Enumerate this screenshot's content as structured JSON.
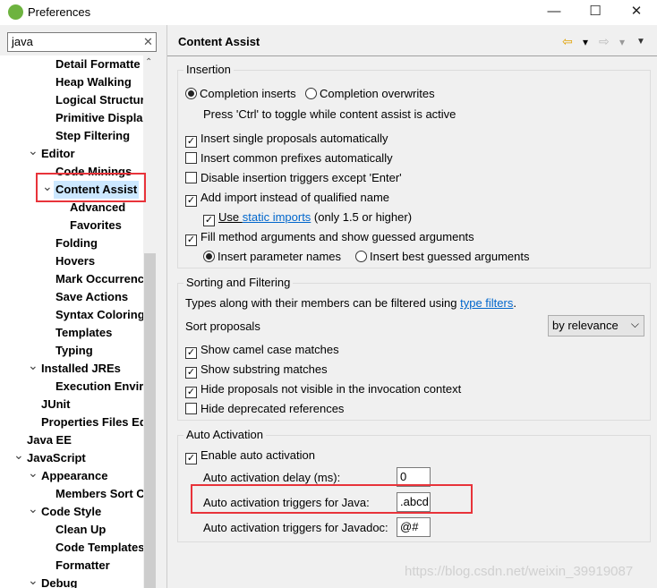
{
  "window": {
    "title": "Preferences",
    "minimize": "—",
    "maximize": "☐",
    "close": "✕"
  },
  "search": {
    "value": "java",
    "clear_icon": "✕"
  },
  "tree": [
    {
      "label": "Detail Formatte",
      "level": 3
    },
    {
      "label": "Heap Walking",
      "level": 3
    },
    {
      "label": "Logical Structur",
      "level": 3
    },
    {
      "label": "Primitive Displa",
      "level": 3
    },
    {
      "label": "Step Filtering",
      "level": 3
    },
    {
      "label": "Editor",
      "level": 2,
      "expanded": true
    },
    {
      "label": "Code Minings",
      "level": 3
    },
    {
      "label": "Content Assist",
      "level": 3,
      "expanded": true,
      "selected": true
    },
    {
      "label": "Advanced",
      "level": 4
    },
    {
      "label": "Favorites",
      "level": 4
    },
    {
      "label": "Folding",
      "level": 3
    },
    {
      "label": "Hovers",
      "level": 3
    },
    {
      "label": "Mark Occurrenc",
      "level": 3
    },
    {
      "label": "Save Actions",
      "level": 3
    },
    {
      "label": "Syntax Coloring",
      "level": 3
    },
    {
      "label": "Templates",
      "level": 3
    },
    {
      "label": "Typing",
      "level": 3
    },
    {
      "label": "Installed JREs",
      "level": 2,
      "expanded": true
    },
    {
      "label": "Execution Envir",
      "level": 3
    },
    {
      "label": "JUnit",
      "level": 2
    },
    {
      "label": "Properties Files Ed",
      "level": 2
    },
    {
      "label": "Java EE",
      "level": 1
    },
    {
      "label": "JavaScript",
      "level": 1,
      "expanded": true
    },
    {
      "label": "Appearance",
      "level": 2,
      "expanded": true
    },
    {
      "label": "Members Sort C",
      "level": 3
    },
    {
      "label": "Code Style",
      "level": 2,
      "expanded": true
    },
    {
      "label": "Clean Up",
      "level": 3
    },
    {
      "label": "Code Templates",
      "level": 3
    },
    {
      "label": "Formatter",
      "level": 3
    },
    {
      "label": "Debug",
      "level": 2,
      "expanded": true
    }
  ],
  "page": {
    "title": "Content Assist",
    "back_icon": "⇦",
    "forward_icon": "⇨",
    "dropdown_icon": "▾",
    "menu_icon": "▼"
  },
  "insertion": {
    "label": "Insertion",
    "radio_inserts": "Completion inserts",
    "radio_overwrites": "Completion overwrites",
    "selected": "Completion inserts",
    "hint": "Press 'Ctrl' to toggle while content assist is active",
    "single": {
      "label": "Insert single proposals automatically",
      "checked": true
    },
    "prefixes": {
      "label": "Insert common prefixes automatically",
      "checked": false
    },
    "disable": {
      "label": "Disable insertion triggers except 'Enter'",
      "checked": false
    },
    "import": {
      "label": "Add import instead of qualified name",
      "checked": true
    },
    "use_static": {
      "label_pre": "Use ",
      "link": "static imports",
      "label_post": " (only 1.5 or higher)",
      "checked": true
    },
    "fill": {
      "label": "Fill method arguments and show guessed arguments",
      "checked": true
    },
    "radio_param": "Insert parameter names",
    "radio_best": "Insert best guessed arguments",
    "fill_selected": "Insert parameter names"
  },
  "sorting": {
    "label": "Sorting and Filtering",
    "desc_pre": "Types along with their members can be filtered using ",
    "desc_link": "type filters",
    "desc_post": ".",
    "sort_label": "Sort proposals",
    "sort_value": "by relevance",
    "camel": {
      "label": "Show camel case matches",
      "checked": true
    },
    "substring": {
      "label": "Show substring matches",
      "checked": true
    },
    "hide_invis": {
      "label": "Hide proposals not visible in the invocation context",
      "checked": true
    },
    "hide_dep": {
      "label": "Hide deprecated references",
      "checked": false
    }
  },
  "auto": {
    "label": "Auto Activation",
    "enable": {
      "label": "Enable auto activation",
      "checked": true
    },
    "delay_label": "Auto activation delay (ms):",
    "delay_value": "0",
    "java_label": "Auto activation triggers for Java:",
    "java_value": ".abcd",
    "javadoc_label": "Auto activation triggers for Javadoc:",
    "javadoc_value": "@#"
  },
  "watermark": "https://blog.csdn.net/weixin_39919087",
  "colors": {
    "highlight": "#e8333a",
    "selection": "#cce8ff",
    "link": "#0066cc",
    "logo": "#6db33f"
  }
}
